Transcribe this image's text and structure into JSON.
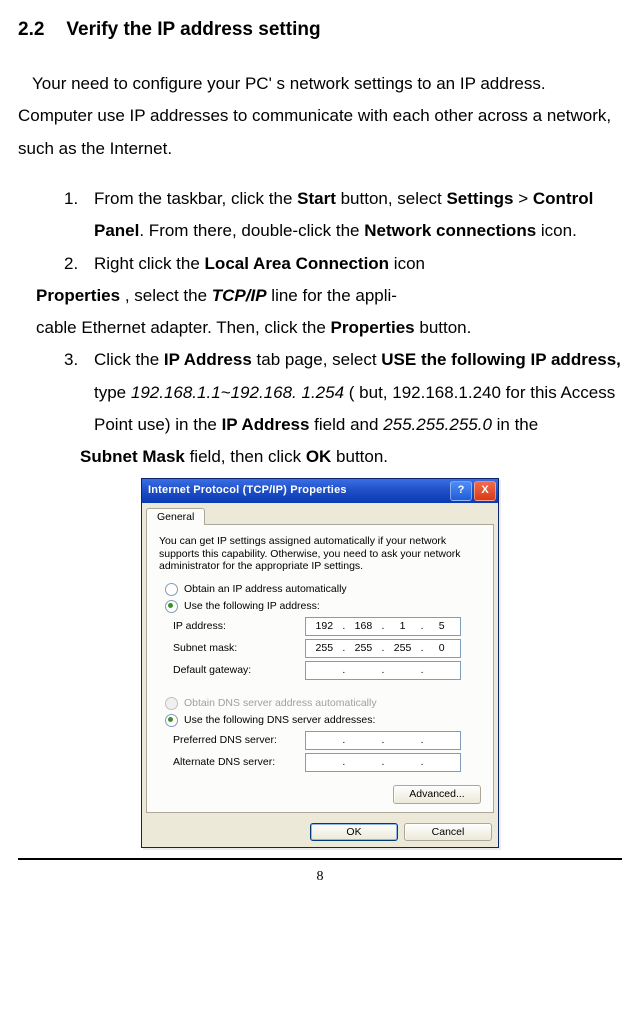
{
  "heading": {
    "number": "2.2",
    "title": "Verify the IP address setting"
  },
  "intro": "Your need to configure your PC' s network settings to an IP address. Computer use IP addresses to communicate with each other across a network, such as the Internet.",
  "steps": {
    "s1": {
      "num": "1.",
      "t1": "From the taskbar, click the ",
      "b1": "Start",
      "t2": " button, select ",
      "b2": "Settings",
      "t3": " > ",
      "b3": "Control Panel",
      "t4": ". From there, double-click the ",
      "b4": "Network connections",
      "t5": " icon."
    },
    "s2": {
      "num": "2.",
      "t1": "Right click the ",
      "b1": "Local Area Connection",
      "t2": " icon ",
      "b2": "Properties",
      "t3": " , select the ",
      "bi1": "TCP/IP",
      "t4": " line for the appli-",
      "t5": "cable Ethernet adapter. Then, click the ",
      "b3": "Properties",
      "t6": " button."
    },
    "s3": {
      "num": "3.",
      "t1": "Click the ",
      "b1": "IP Address",
      "t2": " tab page, select ",
      "b2": "USE the following IP address,",
      "t3": " type ",
      "i1": "192.168.1.1~192.168. 1.254",
      "t4": " ( but, 192.168.1.240 for this Access Point use) in the ",
      "b3": "IP Address",
      "t5": " field and ",
      "i2": "255.255.255.0",
      "t6": " in the ",
      "b4": "Subnet Mask",
      "t7": " field, then click ",
      "b5": "OK",
      "t8": " button."
    }
  },
  "dialog": {
    "title": "Internet Protocol (TCP/IP) Properties",
    "help": "?",
    "close": "X",
    "tab": "General",
    "desc": "You can get IP settings assigned automatically if your network supports this capability. Otherwise, you need to ask your network administrator for the appropriate IP settings.",
    "r1": "Obtain an IP address automatically",
    "r2": "Use the following IP address:",
    "lbl_ip": "IP address:",
    "lbl_mask": "Subnet mask:",
    "lbl_gw": "Default gateway:",
    "ip": {
      "a": "192",
      "b": "168",
      "c": "1",
      "d": "5"
    },
    "mask": {
      "a": "255",
      "b": "255",
      "c": "255",
      "d": "0"
    },
    "r3": "Obtain DNS server address automatically",
    "r4": "Use the following DNS server addresses:",
    "lbl_dns1": "Preferred DNS server:",
    "lbl_dns2": "Alternate DNS server:",
    "adv": "Advanced...",
    "ok": "OK",
    "cancel": "Cancel"
  },
  "page_number": "8"
}
